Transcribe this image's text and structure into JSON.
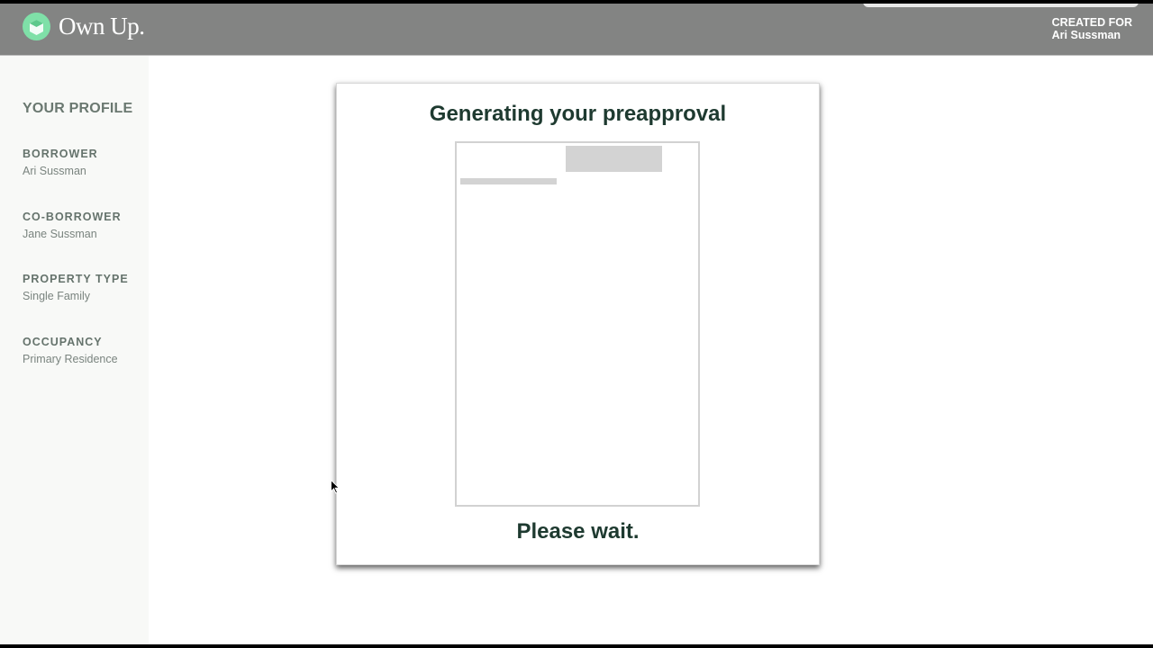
{
  "header": {
    "brand": "Own Up.",
    "created_label": "CREATED FOR",
    "created_name": "Ari Sussman"
  },
  "sidebar": {
    "title": "YOUR PROFILE",
    "items": [
      {
        "label": "BORROWER",
        "value": "Ari Sussman"
      },
      {
        "label": "CO-BORROWER",
        "value": "Jane Sussman"
      },
      {
        "label": "PROPERTY TYPE",
        "value": "Single Family"
      },
      {
        "label": "OCCUPANCY",
        "value": "Primary Residence"
      }
    ]
  },
  "card": {
    "title": "Generating your preapproval",
    "footer": "Please wait."
  },
  "colors": {
    "header_bg": "#838483",
    "brand_green": "#7fe0a8",
    "heading": "#1e3a30"
  }
}
